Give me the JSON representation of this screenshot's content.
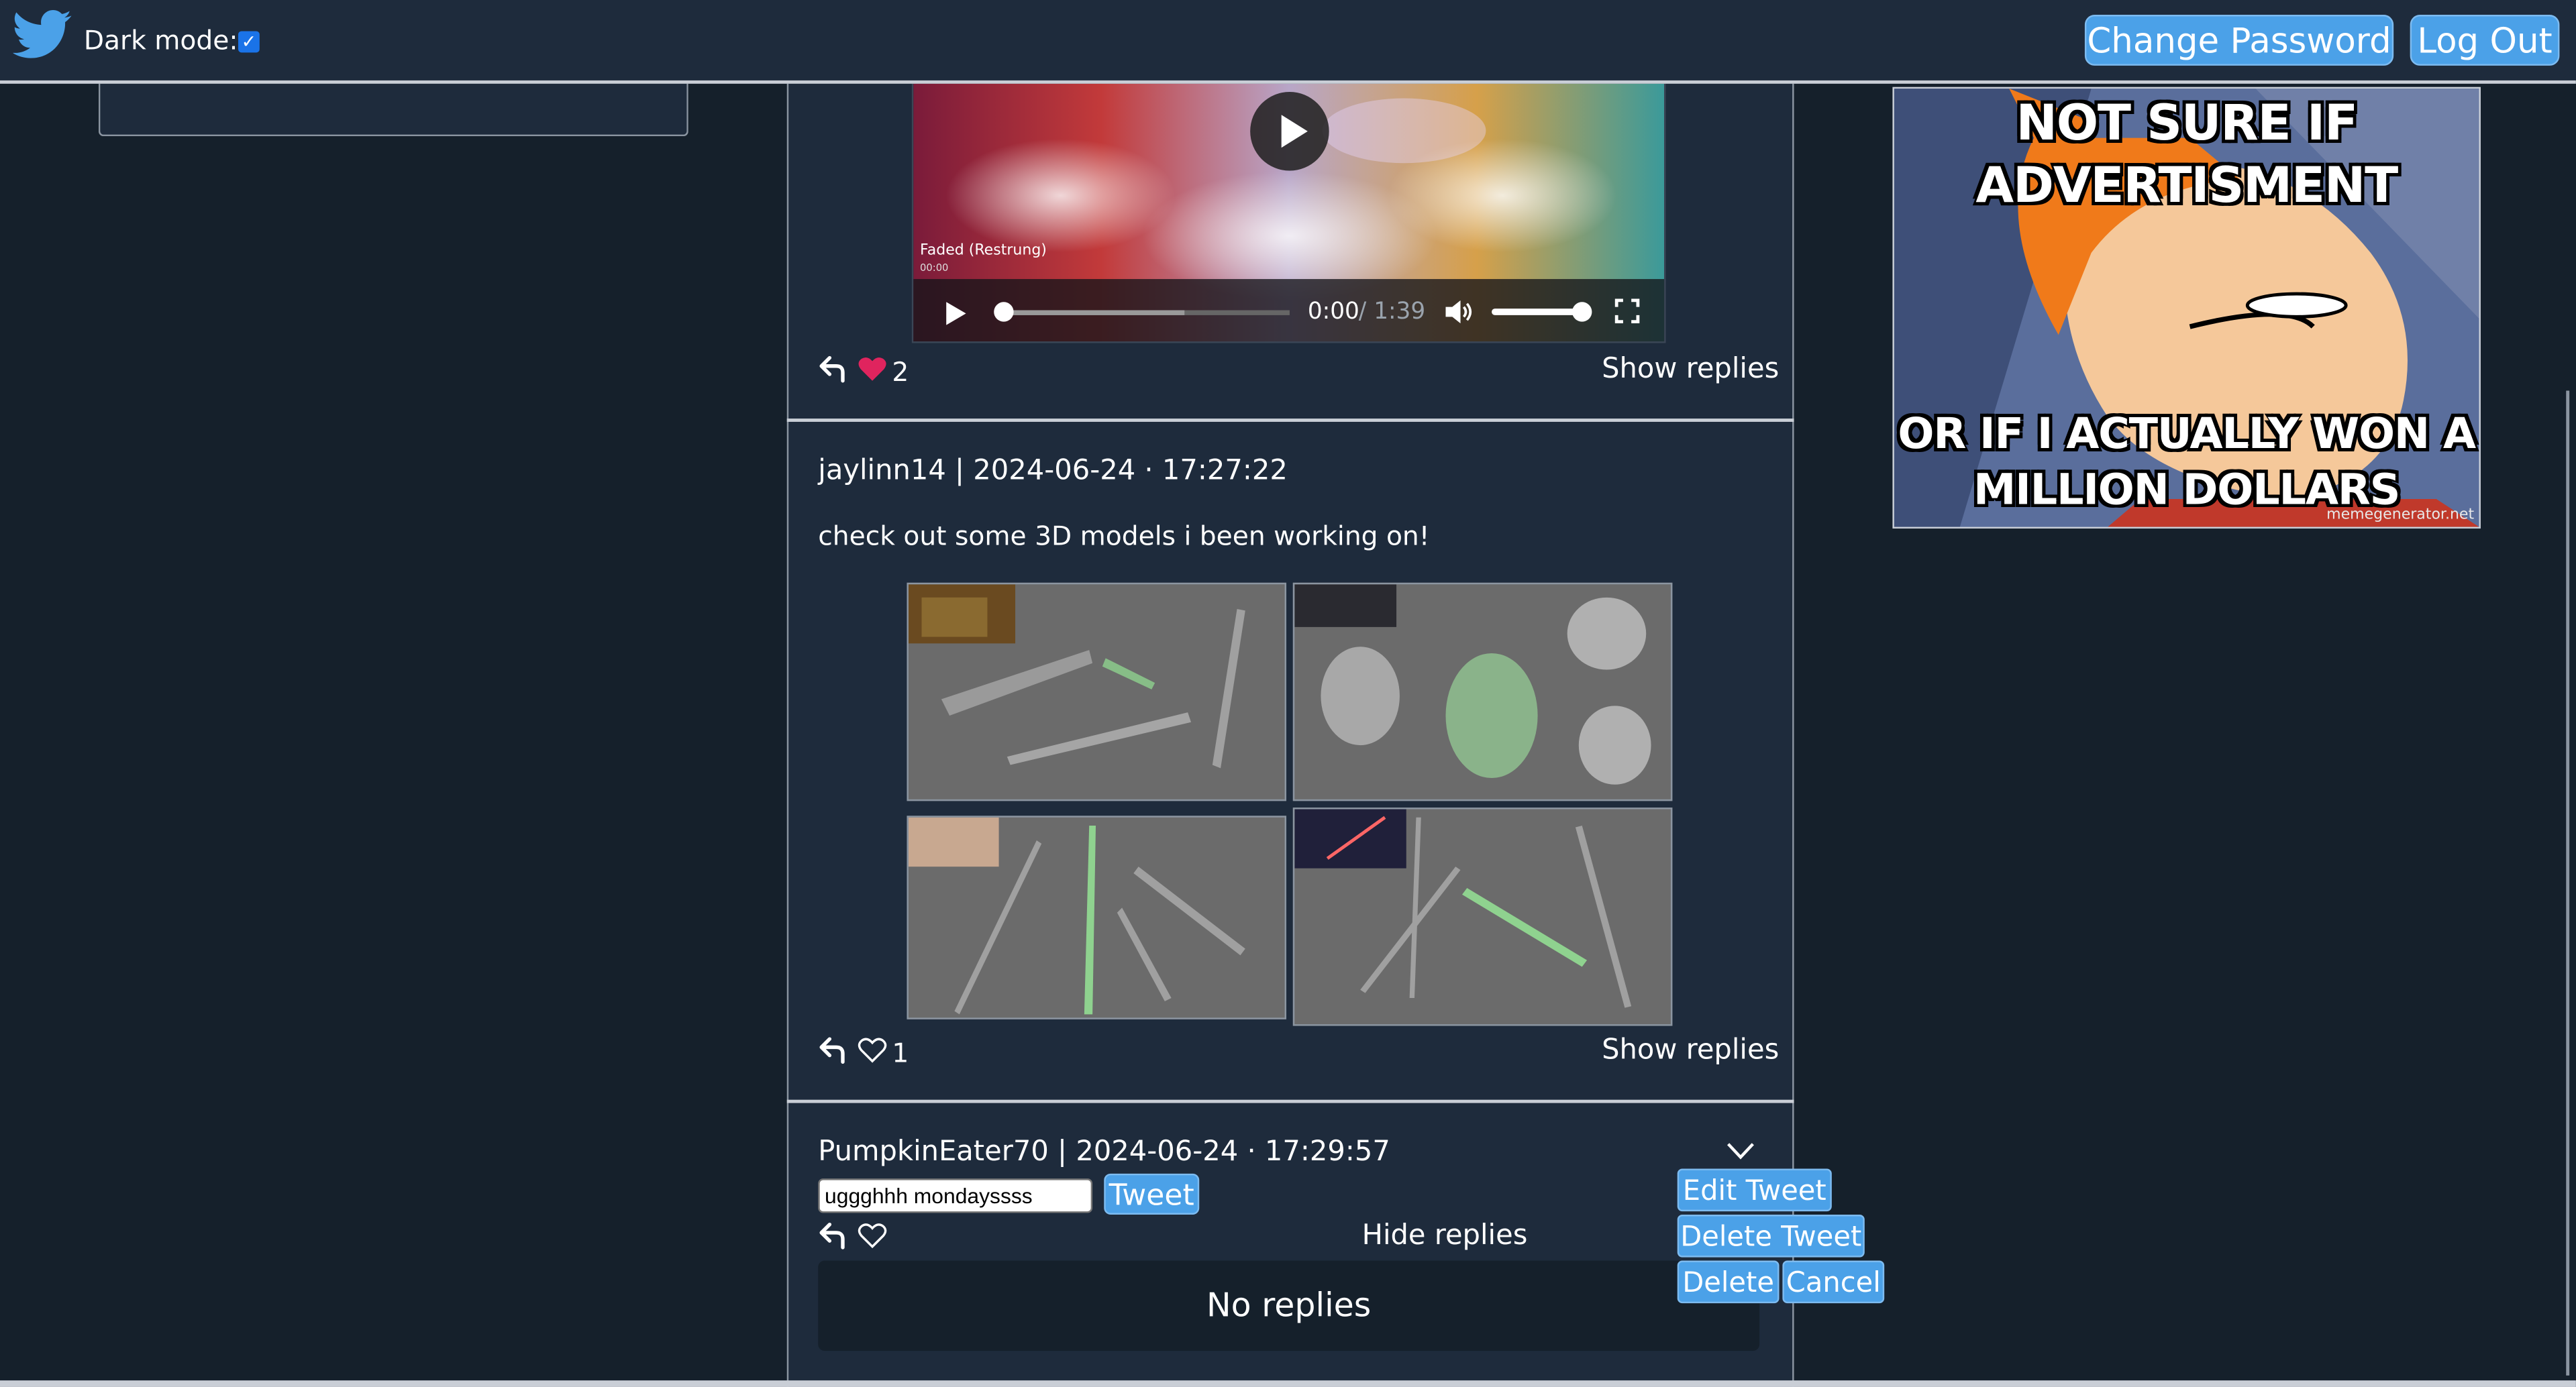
{
  "header": {
    "dark_mode_label": "Dark mode:",
    "dark_mode_checked": true,
    "change_password_label": "Change Password",
    "logout_label": "Log Out"
  },
  "colors": {
    "background": "#15202b",
    "panel": "#1e2b3c",
    "accent": "#4ba1e8",
    "like_red": "#e0245e"
  },
  "video": {
    "title": "Faded (Restrung)",
    "title_time": "00:00",
    "current_time": "0:00",
    "duration": " / 1:39",
    "progress_fraction": 0.0,
    "volume_fraction": 1.0
  },
  "tweets": [
    {
      "likes": "2",
      "liked": true,
      "replies_toggle": "Show replies"
    },
    {
      "username": "jaylinn14",
      "separator": "|",
      "timestamp": "2024-06-24 · 17:27:22",
      "text": "check out some 3D models i been working on!",
      "likes": "1",
      "liked": false,
      "replies_toggle": "Show replies",
      "images": [
        "sniper-rifle-models",
        "helmet-models",
        "sword-models",
        "lightsaber-models"
      ]
    },
    {
      "username": "PumpkinEater70",
      "separator": "|",
      "timestamp": "2024-06-24 · 17:29:57",
      "edit_value": "uggghhh mondayssss",
      "tweet_button": "Tweet",
      "replies_toggle": "Hide replies",
      "no_replies": "No replies",
      "menu": {
        "edit": "Edit Tweet",
        "delete_tweet": "Delete Tweet",
        "delete": "Delete",
        "cancel": "Cancel"
      }
    }
  ],
  "ad": {
    "top_line1": "NOT SURE IF",
    "top_line2": "ADVERTISMENT",
    "bottom_line1": "OR IF I ACTUALLY WON A",
    "bottom_line2": "MILLION DOLLARS",
    "watermark": "memegenerator.net"
  }
}
